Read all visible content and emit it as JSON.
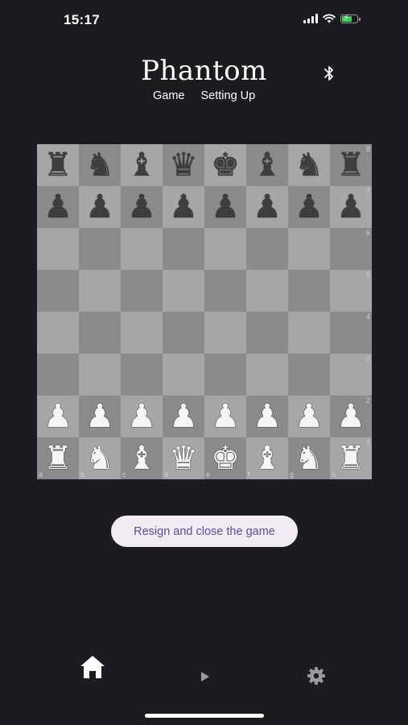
{
  "status_bar": {
    "time": "15:17"
  },
  "header": {
    "title": "Phantom",
    "tabs": [
      {
        "label": "Game"
      },
      {
        "label": "Setting Up"
      }
    ]
  },
  "board": {
    "files": [
      "a",
      "b",
      "c",
      "d",
      "e",
      "f",
      "g",
      "h"
    ],
    "ranks": [
      "8",
      "7",
      "6",
      "5",
      "4",
      "3",
      "2",
      "1"
    ],
    "position": [
      [
        "bR",
        "bN",
        "bB",
        "bQ",
        "bK",
        "bB",
        "bN",
        "bR"
      ],
      [
        "bP",
        "bP",
        "bP",
        "bP",
        "bP",
        "bP",
        "bP",
        "bP"
      ],
      [
        "",
        "",
        "",
        "",
        "",
        "",
        "",
        ""
      ],
      [
        "",
        "",
        "",
        "",
        "",
        "",
        "",
        ""
      ],
      [
        "",
        "",
        "",
        "",
        "",
        "",
        "",
        ""
      ],
      [
        "",
        "",
        "",
        "",
        "",
        "",
        "",
        ""
      ],
      [
        "wP",
        "wP",
        "wP",
        "wP",
        "wP",
        "wP",
        "wP",
        "wP"
      ],
      [
        "wR",
        "wN",
        "wB",
        "wQ",
        "wK",
        "wB",
        "wN",
        "wR"
      ]
    ]
  },
  "actions": {
    "resign_label": "Resign and close the game"
  },
  "bottom_nav": {
    "items": [
      "home-icon",
      "play-icon",
      "gear-icon"
    ]
  },
  "colors": {
    "background": "#1c1b20",
    "light_square": "#a6a6a6",
    "dark_square": "#8b8b8b",
    "button_bg": "#f1ecf4",
    "button_text": "#5d4f96"
  }
}
